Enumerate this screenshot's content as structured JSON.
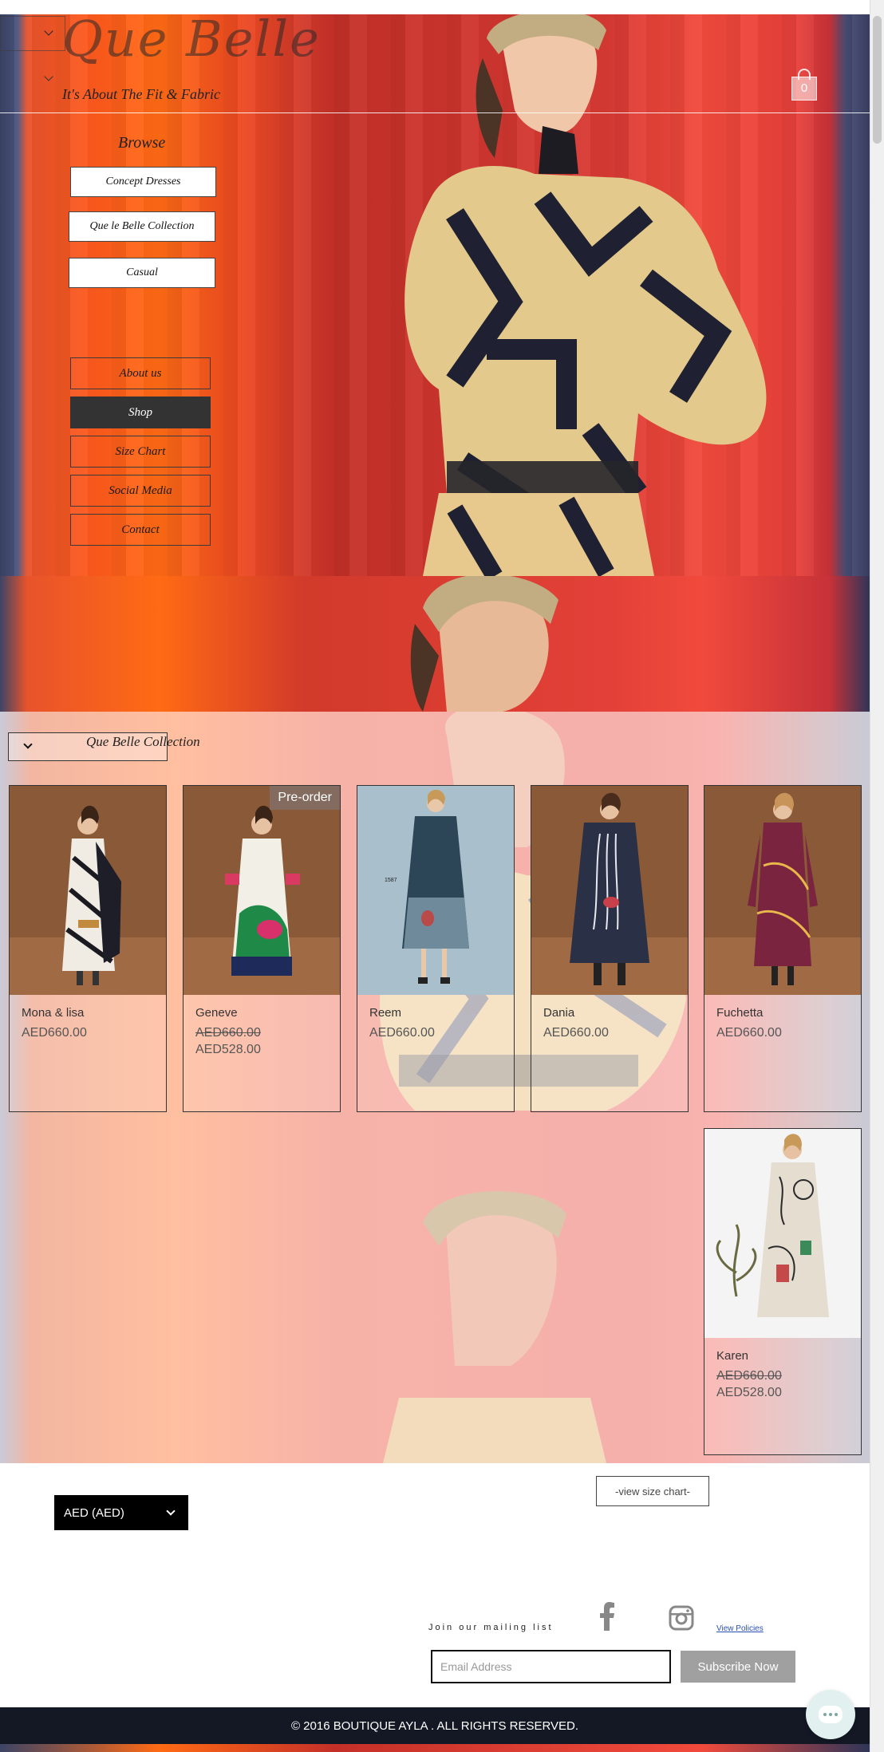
{
  "header": {
    "logo_text": "Que Belle",
    "tagline": "It's About The Fit & Fabric",
    "cart_count": "0"
  },
  "browse": {
    "title": "Browse",
    "buttons": [
      "Concept Dresses",
      "Que le Belle Collection",
      "Casual"
    ]
  },
  "nav": {
    "items": [
      "About us",
      "Shop",
      "Size Chart",
      "Social Media",
      "Contact"
    ],
    "active": "Shop"
  },
  "collection": {
    "title": "Que Belle Collection",
    "products": [
      {
        "name": "Mona & lisa",
        "price": "AED660.00",
        "sale_price": "",
        "badge": ""
      },
      {
        "name": "Geneve",
        "price": "AED660.00",
        "sale_price": "AED528.00",
        "badge": "Pre-order"
      },
      {
        "name": "Reem",
        "price": "AED660.00",
        "sale_price": "",
        "badge": ""
      },
      {
        "name": "Dania",
        "price": "AED660.00",
        "sale_price": "",
        "badge": ""
      },
      {
        "name": "Fuchetta",
        "price": "AED660.00",
        "sale_price": "",
        "badge": ""
      },
      {
        "name": "Karen",
        "price": "AED660.00",
        "sale_price": "AED528.00",
        "badge": ""
      }
    ]
  },
  "footer": {
    "size_chart_button": "-view size chart-",
    "currency": "AED (AED)",
    "mailing_label": "Join our mailing list",
    "email_placeholder": "Email Address",
    "subscribe_label": "Subscribe Now",
    "policies_link": "View Policies",
    "copyright": "© 2016 BOUTIQUE AYLA . ALL RIGHTS RESERVED."
  },
  "colors": {
    "nav_active_bg": "#333333",
    "footer_bar_bg": "#131824",
    "subscribe_bg": "#a0a0a0",
    "currency_bg": "#000000"
  }
}
